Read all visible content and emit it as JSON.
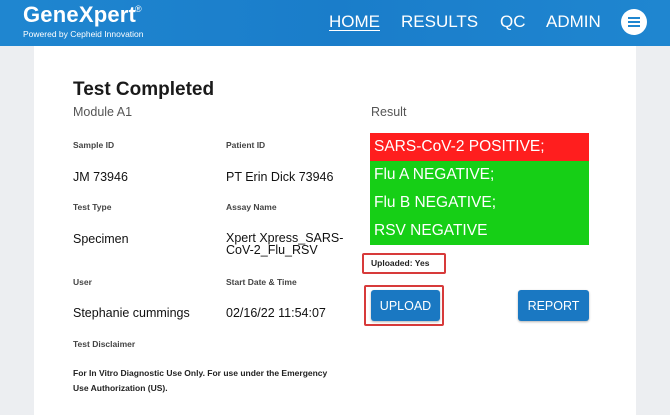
{
  "header": {
    "logo": "GeneXpert",
    "logo_mark": "®",
    "tagline": "Powered by Cepheid Innovation",
    "nav": {
      "home": "HOME",
      "results": "RESULTS",
      "qc": "QC",
      "admin": "ADMIN"
    },
    "menu_icon": "hamburger-menu-icon",
    "colors": {
      "bar": "#1f86d0"
    }
  },
  "test": {
    "title": "Test Completed",
    "module": "Module A1",
    "result_label": "Result",
    "sample_id_label": "Sample ID",
    "sample_id": "JM 73946",
    "patient_id_label": "Patient ID",
    "patient_id": "PT Erin Dick 73946",
    "test_type_label": "Test Type",
    "test_type": "Specimen",
    "assay_name_label": "Assay Name",
    "assay_name_line1": "Xpert Xpress_SARS-",
    "assay_name_line2": "CoV-2_Flu_RSV",
    "user_label": "User",
    "user": "Stephanie cummings",
    "start_label": "Start Date & Time",
    "start": "02/16/22 11:54:07",
    "disclaimer_label": "Test Disclaimer",
    "disclaimer_line1": "For In Vitro Diagnostic Use Only. For use under the Emergency",
    "disclaimer_line2": "Use Authorization (US)."
  },
  "results": [
    {
      "text": "SARS-CoV-2 POSITIVE;",
      "color": "#ff1e1e"
    },
    {
      "text": "Flu A NEGATIVE;",
      "color": "#16cf16"
    },
    {
      "text": "Flu B NEGATIVE;",
      "color": "#16cf16"
    },
    {
      "text": "RSV NEGATIVE",
      "color": "#16cf16"
    }
  ],
  "upload_status": "Uploaded: Yes",
  "buttons": {
    "upload": "UPLOAD",
    "report": "REPORT",
    "color": "#1a78c2"
  }
}
